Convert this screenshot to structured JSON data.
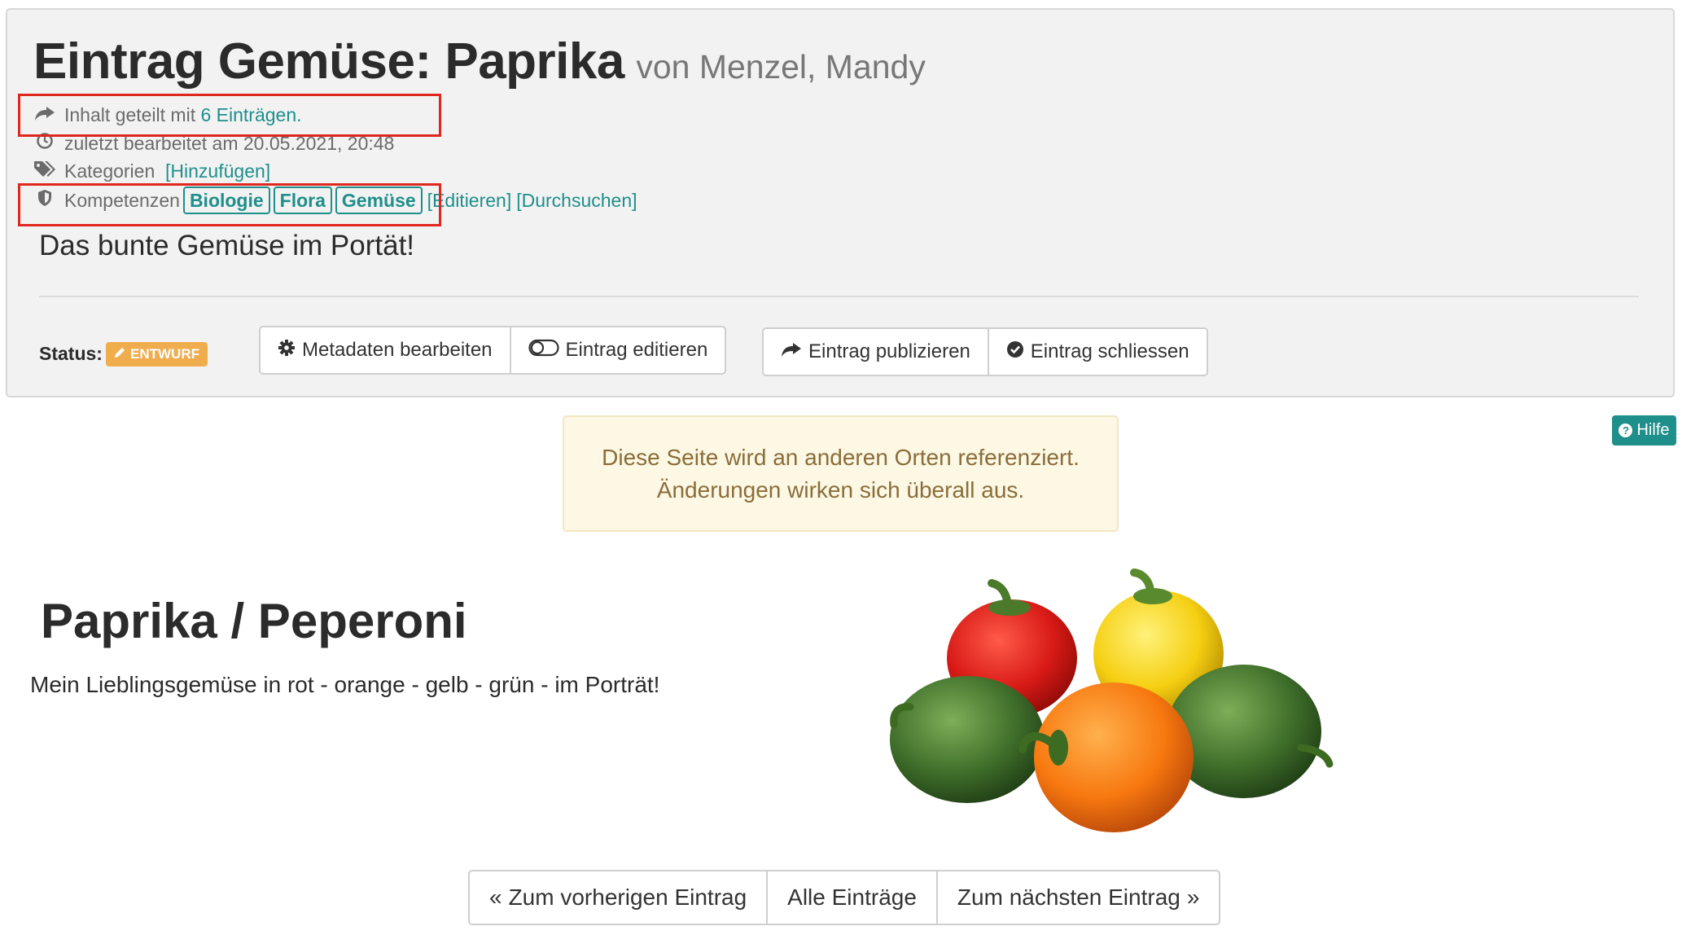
{
  "header": {
    "title": "Eintrag Gemüse: Paprika",
    "author": "von Menzel, Mandy",
    "shared_prefix": "Inhalt geteilt mit",
    "shared_link": "6 Einträgen.",
    "last_edited": "zuletzt bearbeitet am 20.05.2021, 20:48",
    "categories_label": "Kategorien",
    "categories_add": "[Hinzufügen]",
    "competencies_label": "Kompetenzen",
    "competencies": [
      "Biologie",
      "Flora",
      "Gemüse"
    ],
    "competencies_edit": "[Editieren]",
    "competencies_browse": "[Durchsuchen]",
    "description": "Das bunte Gemüse im Portät!"
  },
  "status": {
    "label": "Status:",
    "badge": "ENTWURF",
    "badge_color": "#f0ad4e"
  },
  "toolbar": {
    "edit_metadata": "Metadaten bearbeiten",
    "edit_entry": "Eintrag editieren",
    "publish_entry": "Eintrag publizieren",
    "close_entry": "Eintrag schliessen"
  },
  "help": {
    "label": "Hilfe"
  },
  "alert": {
    "line1": "Diese Seite wird an anderen Orten referenziert.",
    "line2": "Änderungen wirken sich überall aus."
  },
  "content": {
    "title": "Paprika / Peperoni",
    "text": "Mein Lieblingsgemüse in rot - orange - gelb - grün - im Porträt!"
  },
  "pager": {
    "previous": "Zum vorherigen Eintrag",
    "all": "Alle Einträge",
    "next": "Zum nächsten Eintrag"
  },
  "icons": {
    "shared": "share-icon",
    "edited": "clock-icon",
    "categories": "tags-icon",
    "competencies": "shield-icon",
    "edit_metadata": "gear-icon",
    "edit_entry": "toggle-icon",
    "publish": "share-icon",
    "close": "check-circle-icon"
  },
  "colors": {
    "accent": "#1e8f8b",
    "highlight": "#e0271f",
    "alert_text": "#8a6d3b",
    "alert_bg": "#fcf8e3"
  }
}
